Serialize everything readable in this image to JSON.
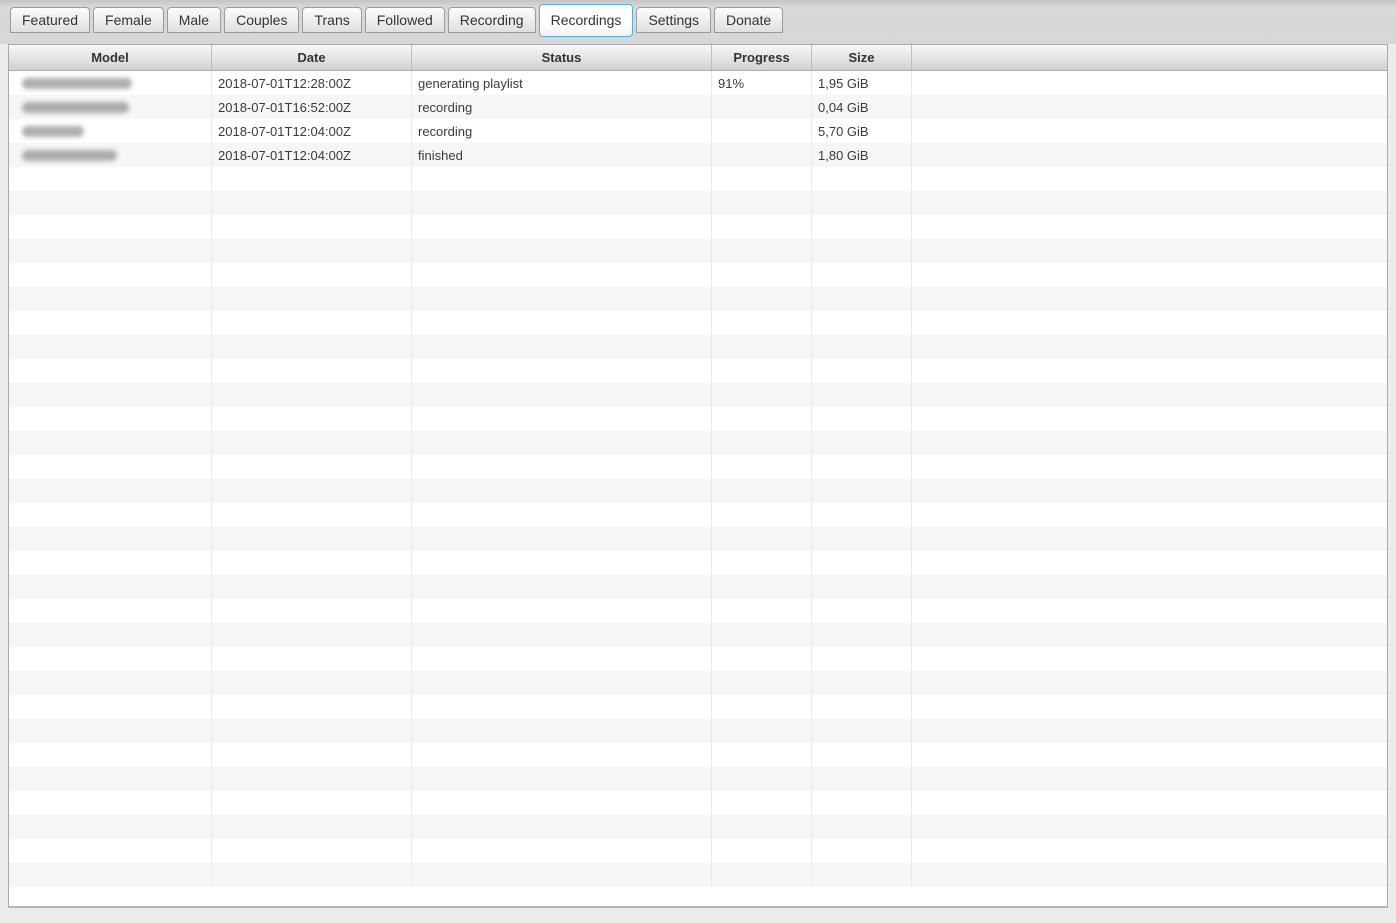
{
  "tabs": [
    {
      "label": "Featured",
      "active": false
    },
    {
      "label": "Female",
      "active": false
    },
    {
      "label": "Male",
      "active": false
    },
    {
      "label": "Couples",
      "active": false
    },
    {
      "label": "Trans",
      "active": false
    },
    {
      "label": "Followed",
      "active": false
    },
    {
      "label": "Recording",
      "active": false
    },
    {
      "label": "Recordings",
      "active": true
    },
    {
      "label": "Settings",
      "active": false
    },
    {
      "label": "Donate",
      "active": false
    }
  ],
  "table": {
    "columns": [
      "Model",
      "Date",
      "Status",
      "Progress",
      "Size",
      ""
    ],
    "rows": [
      {
        "model_redacted": true,
        "date": "2018-07-01T12:28:00Z",
        "status": "generating playlist",
        "progress": "91%",
        "size": "1,95 GiB"
      },
      {
        "model_redacted": true,
        "date": "2018-07-01T16:52:00Z",
        "status": "recording",
        "progress": "",
        "size": "0,04 GiB"
      },
      {
        "model_redacted": true,
        "date": "2018-07-01T12:04:00Z",
        "status": "recording",
        "progress": "",
        "size": "5,70 GiB"
      },
      {
        "model_redacted": true,
        "date": "2018-07-01T12:04:00Z",
        "status": "finished",
        "progress": "",
        "size": "1,80 GiB"
      }
    ],
    "empty_row_count": 30
  },
  "colors": {
    "active_tab_border": "#57aede",
    "row_stripe": "#f6f6f6",
    "header_text": "#333333",
    "table_border": "#a9a9a9"
  }
}
